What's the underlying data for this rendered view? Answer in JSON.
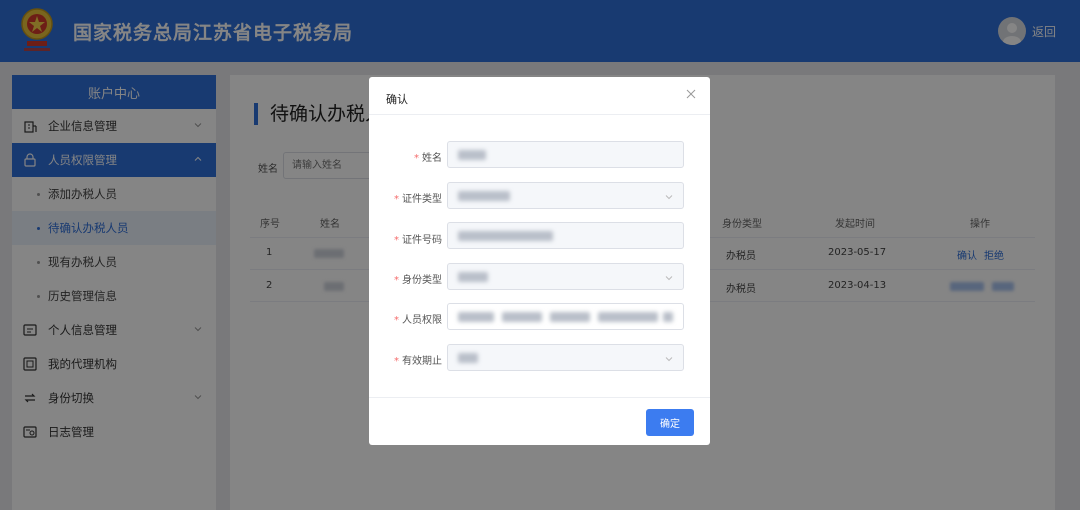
{
  "header": {
    "title": "国家税务总局江苏省电子税务局",
    "back_label": "返回"
  },
  "sidebar": {
    "header": "账户中心",
    "items": [
      {
        "label": "企业信息管理"
      },
      {
        "label": "人员权限管理"
      },
      {
        "label": "个人信息管理"
      },
      {
        "label": "我的代理机构"
      },
      {
        "label": "身份切换"
      },
      {
        "label": "日志管理"
      }
    ],
    "sub_items": [
      {
        "label": "添加办税人员"
      },
      {
        "label": "待确认办税人员"
      },
      {
        "label": "现有办税人员"
      },
      {
        "label": "历史管理信息"
      }
    ]
  },
  "main": {
    "page_title": "待确认办税人员",
    "filter_label": "姓名",
    "filter_placeholder": "请输入姓名",
    "columns": [
      "序号",
      "姓名",
      "身份类型",
      "发起时间",
      "操作"
    ],
    "rows": [
      {
        "index": "1",
        "role": "办税员",
        "date": "2023-05-17",
        "action_confirm": "确认",
        "action_reject": "拒绝"
      },
      {
        "index": "2",
        "role": "办税员",
        "date": "2023-04-13"
      }
    ]
  },
  "modal": {
    "title": "确认",
    "fields": [
      {
        "label": "姓名"
      },
      {
        "label": "证件类型"
      },
      {
        "label": "证件号码"
      },
      {
        "label": "身份类型"
      },
      {
        "label": "人员权限"
      },
      {
        "label": "有效期止"
      }
    ],
    "required_mark": "*",
    "confirm_label": "确定"
  },
  "colors": {
    "primary": "#2f6fd9",
    "button": "#3c7cf0",
    "required": "#f56c6c"
  }
}
